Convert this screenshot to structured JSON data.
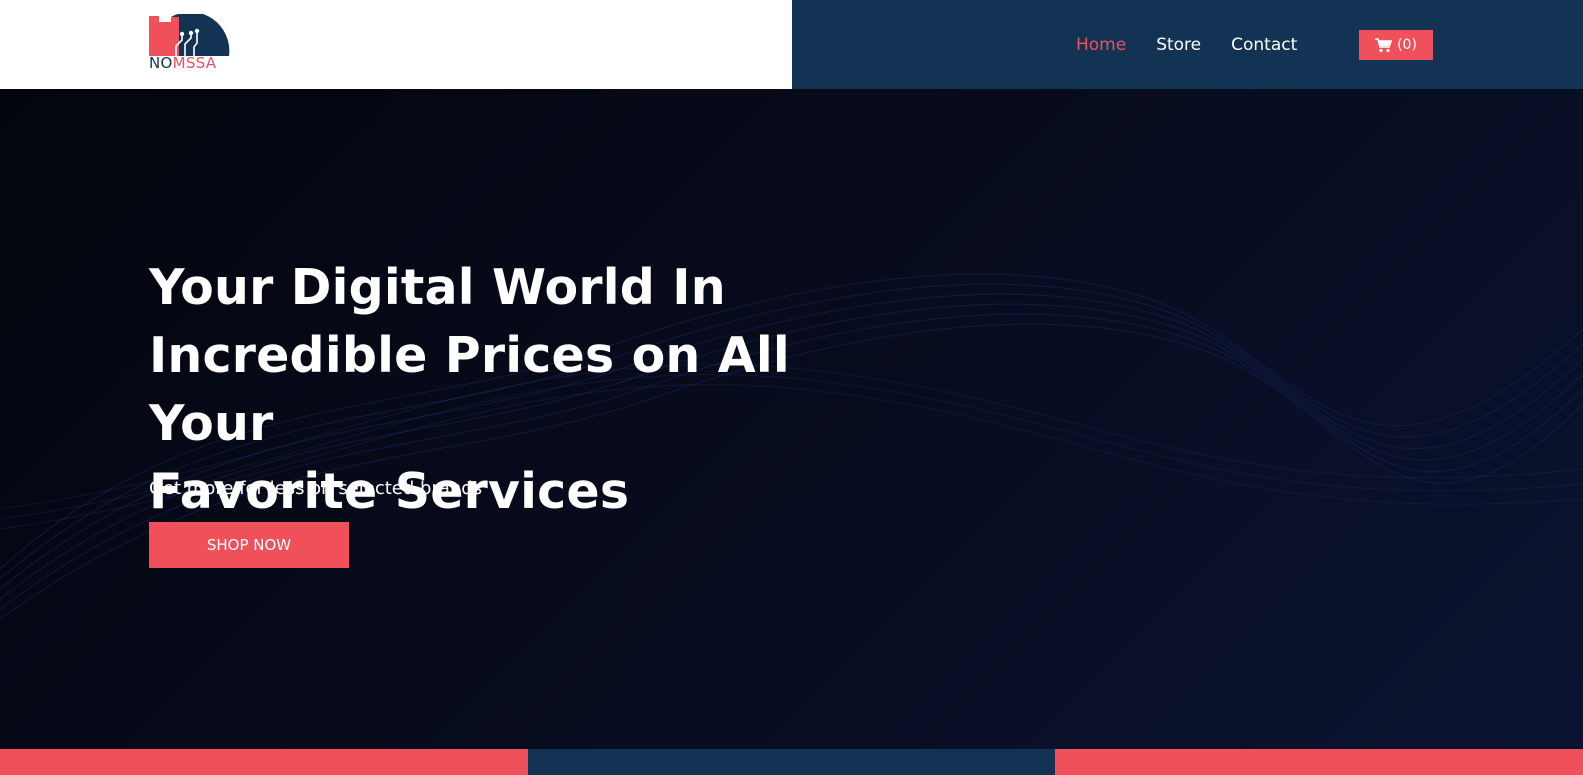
{
  "brand": {
    "logo_text_dark": "NO",
    "logo_text_accent": "MSSA",
    "logo_icon": "logo-icon",
    "accent_color": "#f0505a",
    "navy_color": "#133354"
  },
  "nav": {
    "items": [
      {
        "label": "Home",
        "active": true
      },
      {
        "label": "Store",
        "active": false
      },
      {
        "label": "Contact",
        "active": false
      }
    ],
    "cart_icon": "shopping-cart-icon",
    "cart_count": "(0)"
  },
  "hero": {
    "title_line1": "Your Digital World In",
    "title_line2": "Incredible Prices on All Your",
    "title_line3": "Favorite Services",
    "subtitle": "Get more for less on selected brands",
    "cta_label": "SHOP NOW"
  }
}
